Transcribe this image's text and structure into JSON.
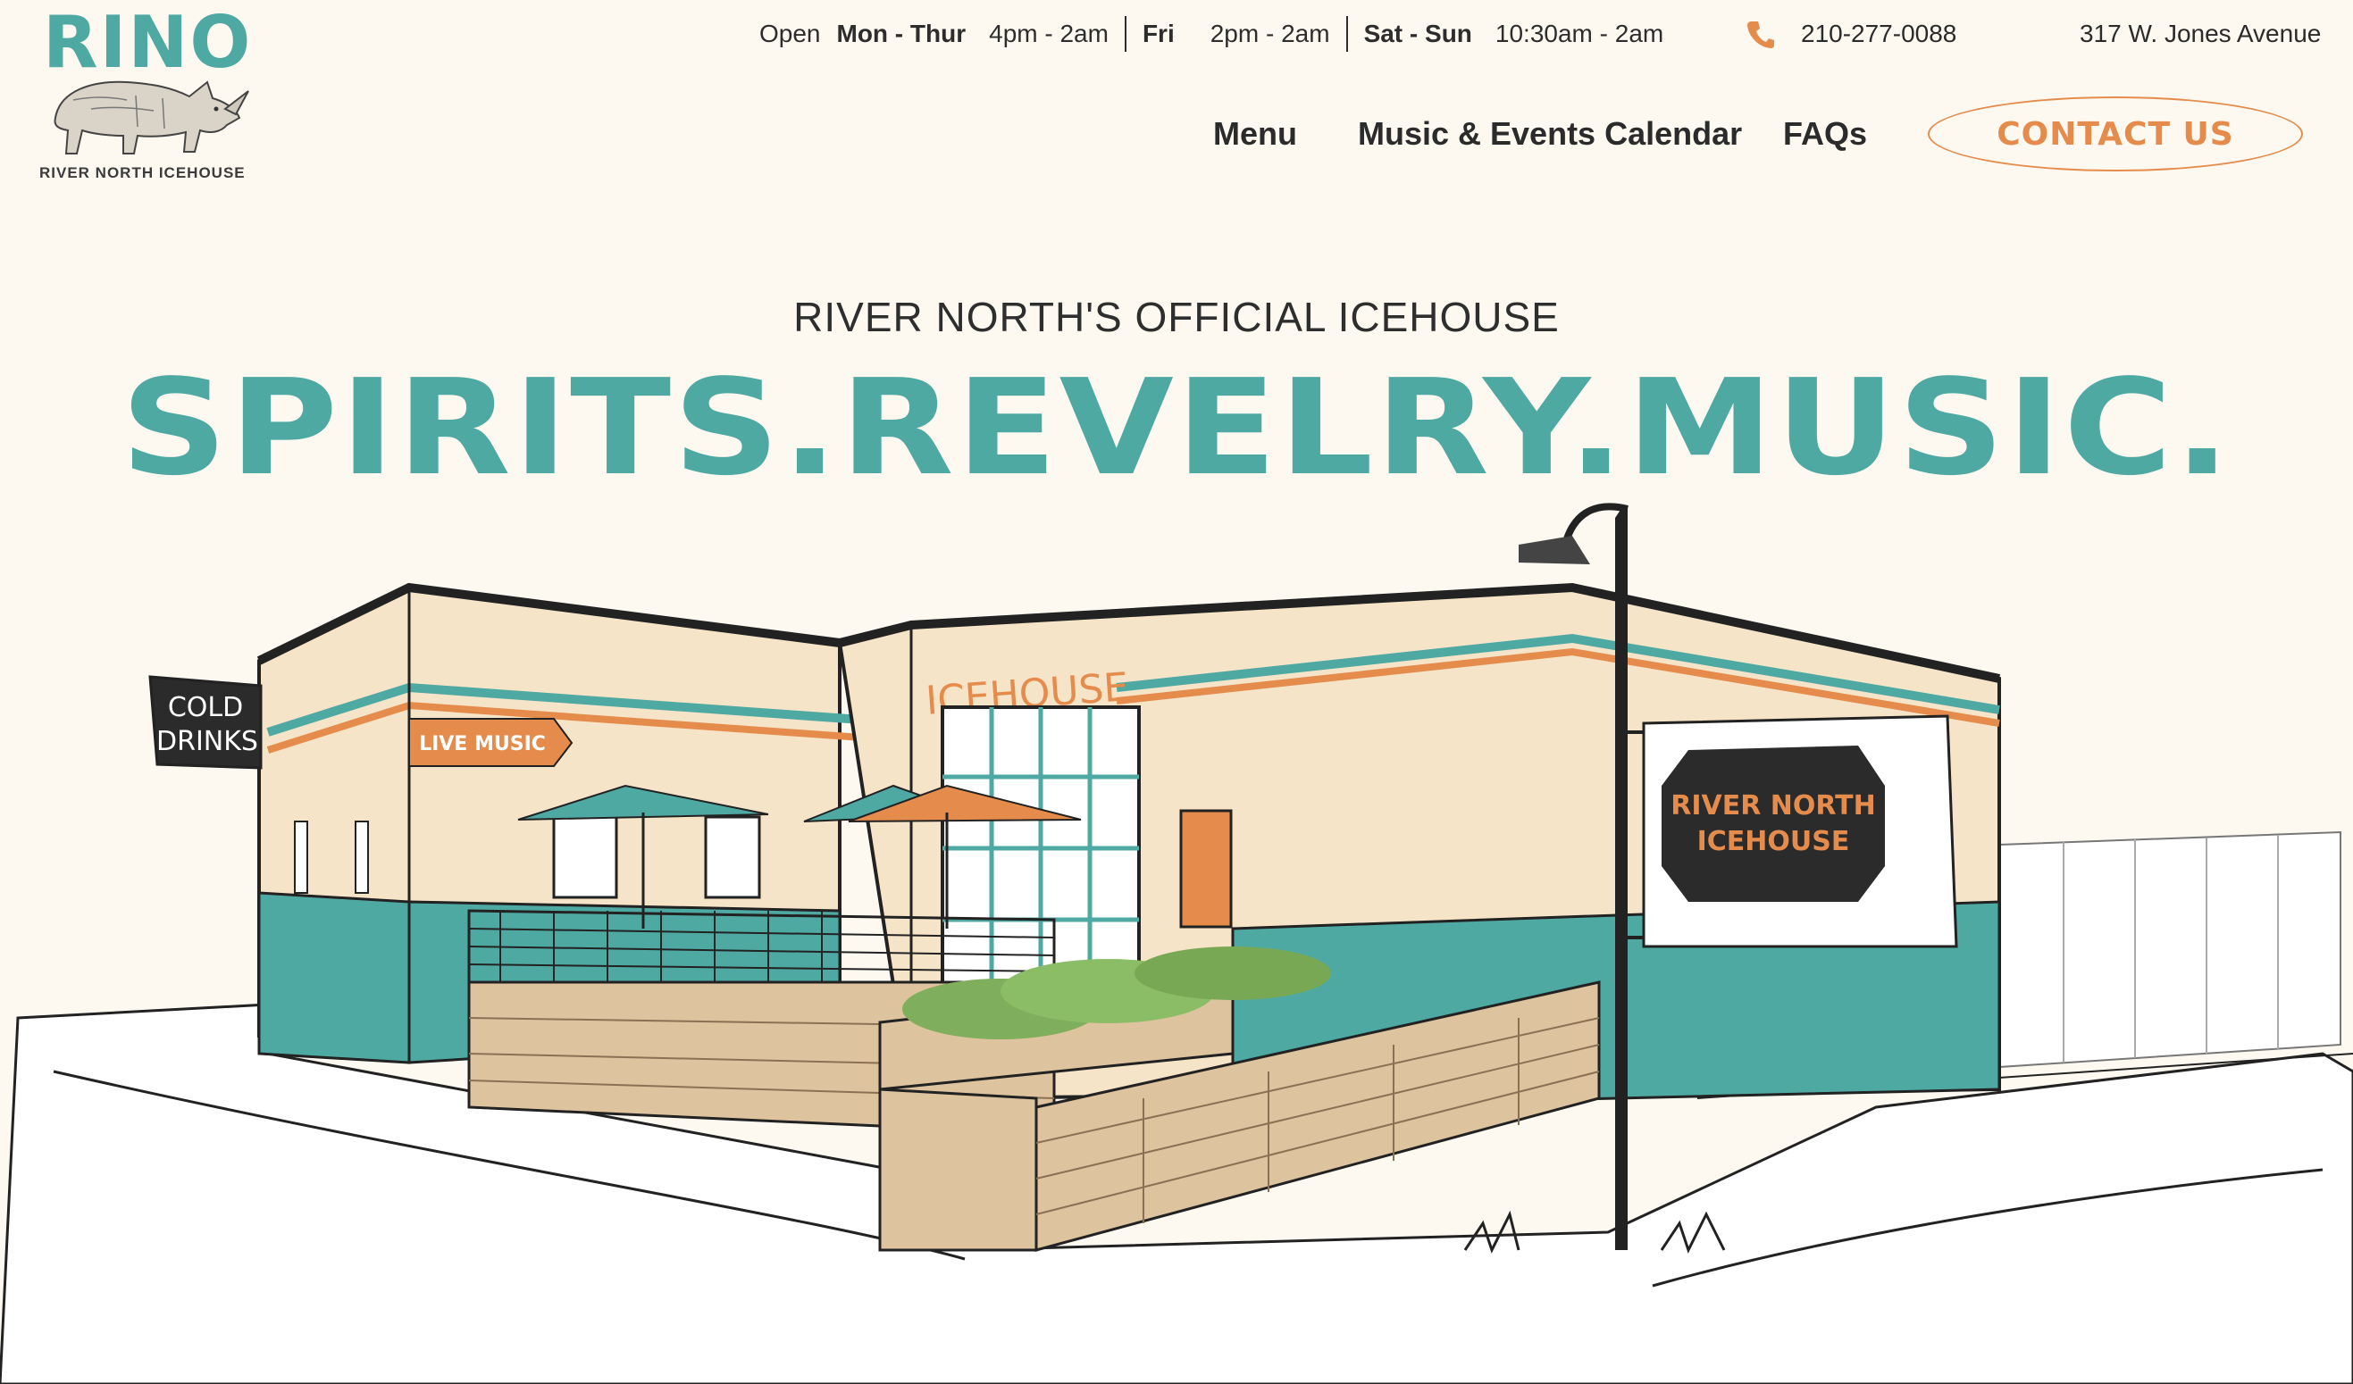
{
  "brand": {
    "name": "RINO",
    "subtitle": "RIVER NORTH ICEHOUSE"
  },
  "hours": {
    "open_label": "Open",
    "entries": [
      {
        "days": "Mon - Thur",
        "time": "4pm - 2am"
      },
      {
        "days": "Fri",
        "time": "2pm - 2am"
      },
      {
        "days": "Sat - Sun",
        "time": "10:30am - 2am"
      }
    ]
  },
  "contact": {
    "phone": "210-277-0088",
    "address": "317 W. Jones Avenue"
  },
  "nav": {
    "menu": "Menu",
    "music": "Music & Events Calendar",
    "faqs": "FAQs",
    "contact": "CONTACT US"
  },
  "hero": {
    "tagline": "RIVER NORTH'S OFFICIAL ICEHOUSE",
    "headline": "SPIRITS.REVELRY.MUSIC."
  },
  "illustration": {
    "sign_cold_line1": "COLD",
    "sign_cold_line2": "DRINKS",
    "sign_live_music": "LIVE MUSIC",
    "sign_icehouse": "ICEHOUSE",
    "sign_rn_line1": "RIVER NORTH",
    "sign_rn_line2": "ICEHOUSE"
  },
  "colors": {
    "teal": "#4fa9a3",
    "orange": "#e58c4c",
    "background": "#fdf9f1",
    "dark": "#2b2b2b"
  }
}
